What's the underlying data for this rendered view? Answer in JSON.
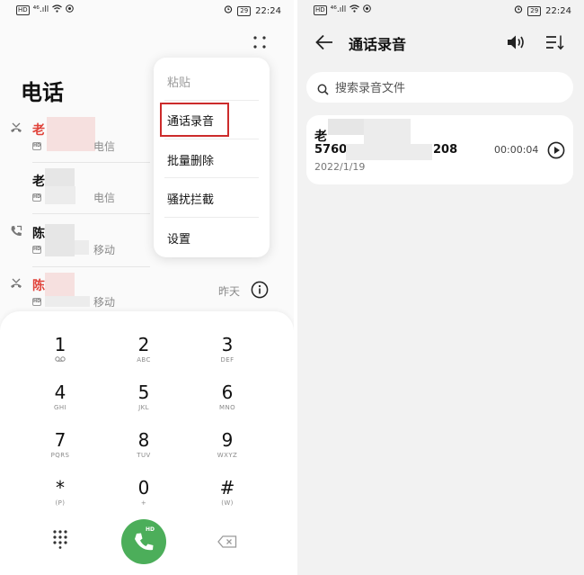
{
  "status_bar": {
    "hd": "HD",
    "signal": "⁴⁶.ıll",
    "battery": "29",
    "time": "22:24"
  },
  "left_screen": {
    "title": "电话",
    "more_icon": "more-dots-icon",
    "menu": {
      "items": [
        {
          "label": "粘贴",
          "enabled": false
        },
        {
          "label": "通话录音",
          "enabled": true,
          "highlighted": true
        },
        {
          "label": "批量删除",
          "enabled": true
        },
        {
          "label": "骚扰拦截",
          "enabled": true
        },
        {
          "label": "设置",
          "enabled": true
        }
      ],
      "highlight_color": "#cc2b2b"
    },
    "call_log": [
      {
        "name": "老",
        "carrier": "电信",
        "type": "missed",
        "time": ""
      },
      {
        "name": "老",
        "carrier": "电信",
        "type": "normal",
        "time": ""
      },
      {
        "name": "陈",
        "carrier": "移动",
        "type": "outgoing",
        "time": ""
      },
      {
        "name": "陈",
        "carrier": "移动",
        "type": "missed",
        "time": "昨天"
      }
    ],
    "dialpad": {
      "keys": [
        {
          "digit": "1",
          "letters": "oo"
        },
        {
          "digit": "2",
          "letters": "ABC"
        },
        {
          "digit": "3",
          "letters": "DEF"
        },
        {
          "digit": "4",
          "letters": "GHI"
        },
        {
          "digit": "5",
          "letters": "JKL"
        },
        {
          "digit": "6",
          "letters": "MNO"
        },
        {
          "digit": "7",
          "letters": "PQRS"
        },
        {
          "digit": "8",
          "letters": "TUV"
        },
        {
          "digit": "9",
          "letters": "WXYZ"
        },
        {
          "digit": "*",
          "letters": "(P)"
        },
        {
          "digit": "0",
          "letters": "+"
        },
        {
          "digit": "#",
          "letters": "(W)"
        }
      ],
      "call_badge": "HD",
      "call_color": "#4cae5a"
    }
  },
  "right_screen": {
    "title": "通话录音",
    "search_placeholder": "搜索录音文件",
    "recording": {
      "name": "老",
      "number_start": "5760",
      "number_end": "208",
      "date": "2022/1/19",
      "duration": "00:00:04"
    }
  },
  "colors": {
    "missed": "#e0433a",
    "accent_green": "#4cae5a"
  }
}
